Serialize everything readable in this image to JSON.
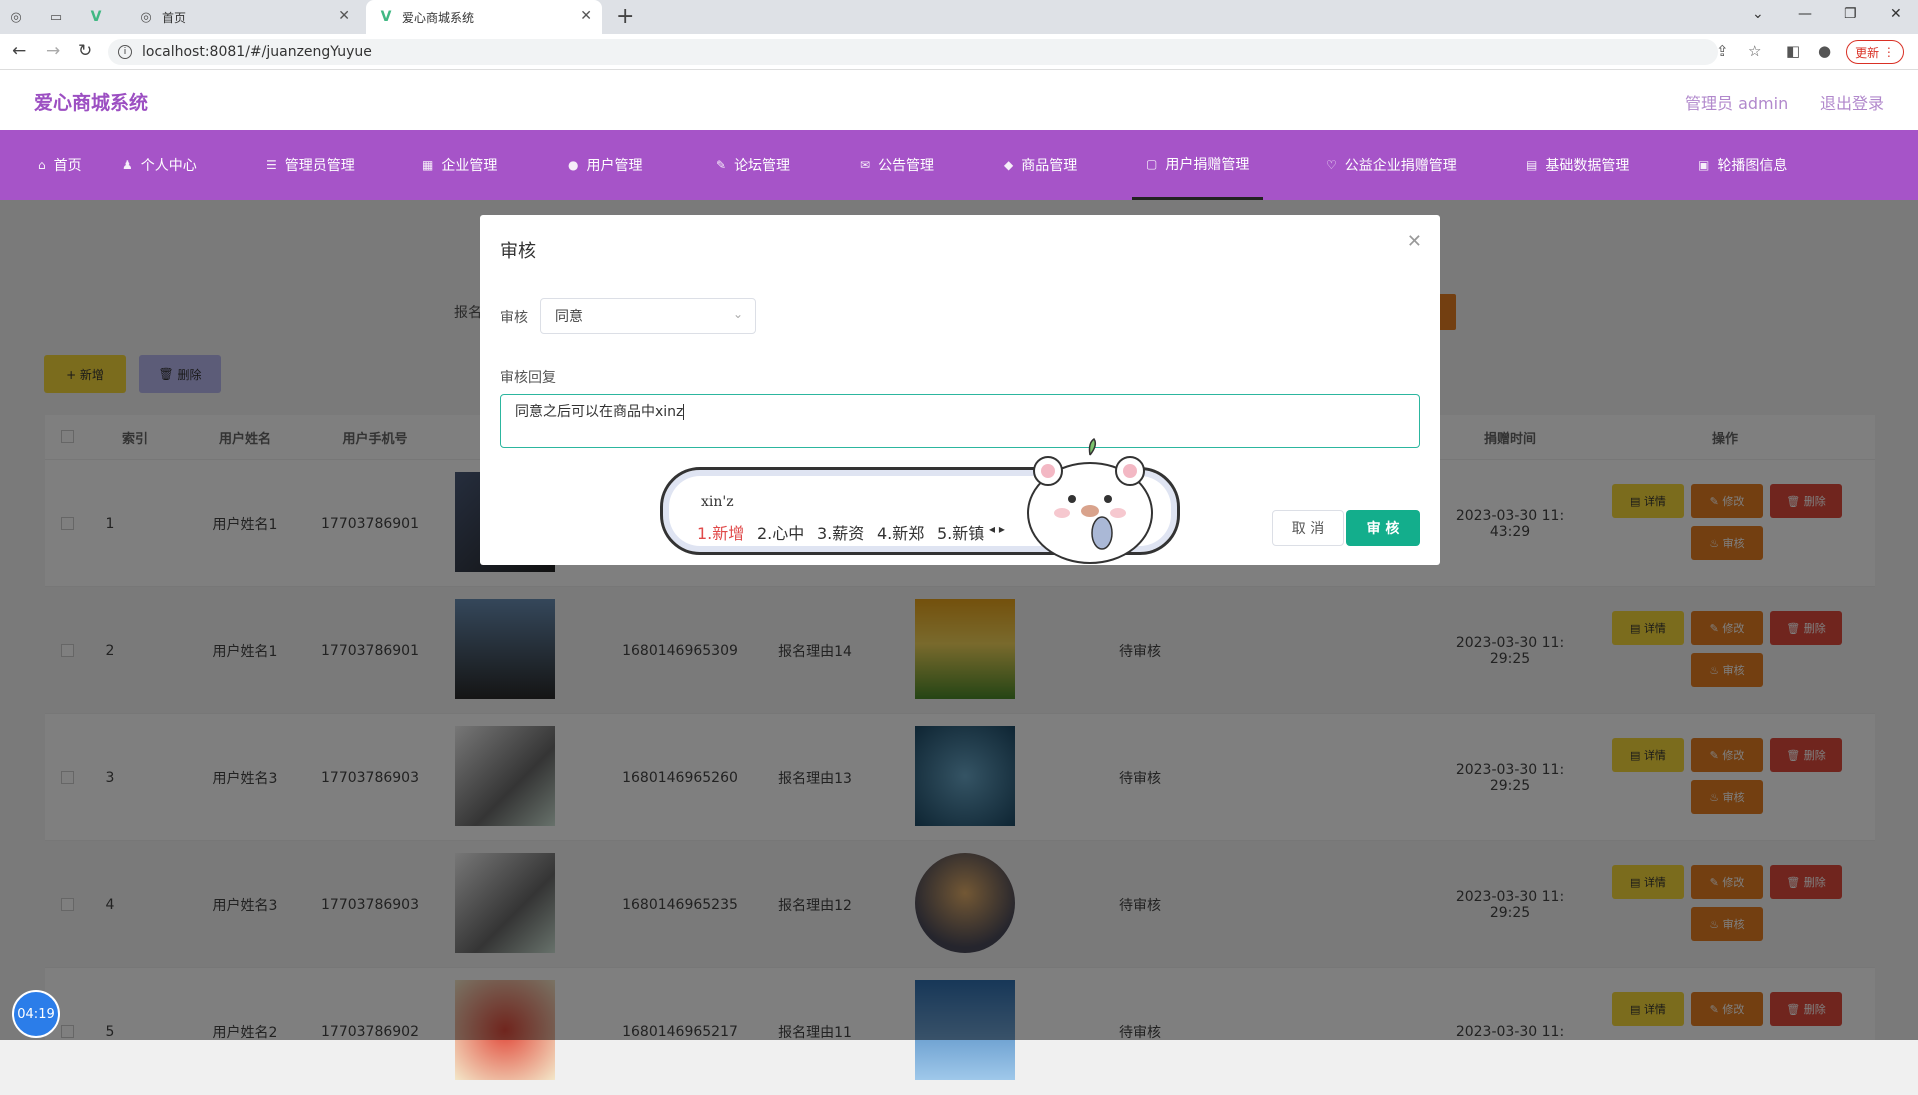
{
  "browser": {
    "tabs": [
      {
        "icon": "globe-icon",
        "label": ""
      },
      {
        "icon": "blank-page-icon",
        "label": ""
      },
      {
        "icon": "vue-icon",
        "label": ""
      },
      {
        "icon": "globe-icon",
        "label": "首页"
      },
      {
        "icon": "vue-icon",
        "label": "爱心商城系统"
      }
    ],
    "url": "localhost:8081/#/juanzengYuyue",
    "update_label": "更新"
  },
  "app": {
    "title": "爱心商城系统",
    "admin_label": "管理员 admin",
    "logout_label": "退出登录",
    "menu": [
      {
        "label": "首页"
      },
      {
        "label": "个人中心"
      },
      {
        "label": "管理员管理"
      },
      {
        "label": "企业管理"
      },
      {
        "label": "用户管理"
      },
      {
        "label": "论坛管理"
      },
      {
        "label": "公告管理"
      },
      {
        "label": "商品管理"
      },
      {
        "label": "用户捐赠管理"
      },
      {
        "label": "公益企业捐赠管理"
      },
      {
        "label": "基础数据管理"
      },
      {
        "label": "轮播图信息"
      }
    ],
    "search_label": "报名",
    "add_label": "+ 新增",
    "delete_label": "删除"
  },
  "table": {
    "headers": [
      "索引",
      "用户姓名",
      "用户手机号",
      "",
      "",
      "",
      "",
      "",
      "",
      "捐赠时间",
      "操作"
    ],
    "rows": [
      {
        "index": "1",
        "name": "用户姓名1",
        "phone": "17703786901",
        "code": "",
        "reason": "",
        "status": "",
        "time1": "2023-03-30 11:",
        "time2": "43:29"
      },
      {
        "index": "2",
        "name": "用户姓名1",
        "phone": "17703786901",
        "code": "1680146965309",
        "reason": "报名理由14",
        "status": "待审核",
        "time1": "2023-03-30 11:",
        "time2": "29:25"
      },
      {
        "index": "3",
        "name": "用户姓名3",
        "phone": "17703786903",
        "code": "1680146965260",
        "reason": "报名理由13",
        "status": "待审核",
        "time1": "2023-03-30 11:",
        "time2": "29:25"
      },
      {
        "index": "4",
        "name": "用户姓名3",
        "phone": "17703786903",
        "code": "1680146965235",
        "reason": "报名理由12",
        "status": "待审核",
        "time1": "2023-03-30 11:",
        "time2": "29:25"
      },
      {
        "index": "5",
        "name": "用户姓名2",
        "phone": "17703786902",
        "code": "1680146965217",
        "reason": "报名理由11",
        "status": "待审核",
        "time1": "2023-03-30 11:",
        "time2": ""
      }
    ],
    "action_labels": {
      "detail": "详情",
      "edit": "修改",
      "delete": "删除",
      "audit": "审核"
    }
  },
  "dialog": {
    "title": "审核",
    "audit_label": "审核",
    "audit_value": "同意",
    "reply_label": "审核回复",
    "reply_value": "同意之后可以在商品中xinz",
    "cancel_label": "取 消",
    "confirm_label": "审 核"
  },
  "ime": {
    "composition": "xin'z",
    "candidates": [
      "1.新增",
      "2.心中",
      "3.薪资",
      "4.新郑",
      "5.新镇"
    ]
  },
  "timer": "04:19",
  "colors": {
    "menu": "#a654c8",
    "title": "#9c4fc2",
    "confirm": "#13ae8c",
    "accent": "#e67e22"
  }
}
